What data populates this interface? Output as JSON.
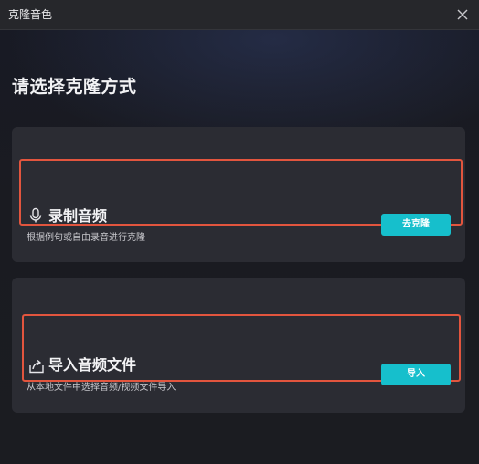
{
  "window": {
    "title": "克隆音色"
  },
  "main": {
    "heading": "请选择克隆方式"
  },
  "options": [
    {
      "title": "录制音频",
      "description": "根据例句或自由录音进行克隆",
      "button_label": "去克隆",
      "icon": "microphone-icon"
    },
    {
      "title": "导入音频文件",
      "description": "从本地文件中选择音频/视频文件导入",
      "button_label": "导入",
      "icon": "import-file-icon"
    }
  ],
  "colors": {
    "accent": "#16bfcc",
    "highlight_border": "#e2553e",
    "card_background": "#2b2c33",
    "window_background": "#1b1c21"
  }
}
